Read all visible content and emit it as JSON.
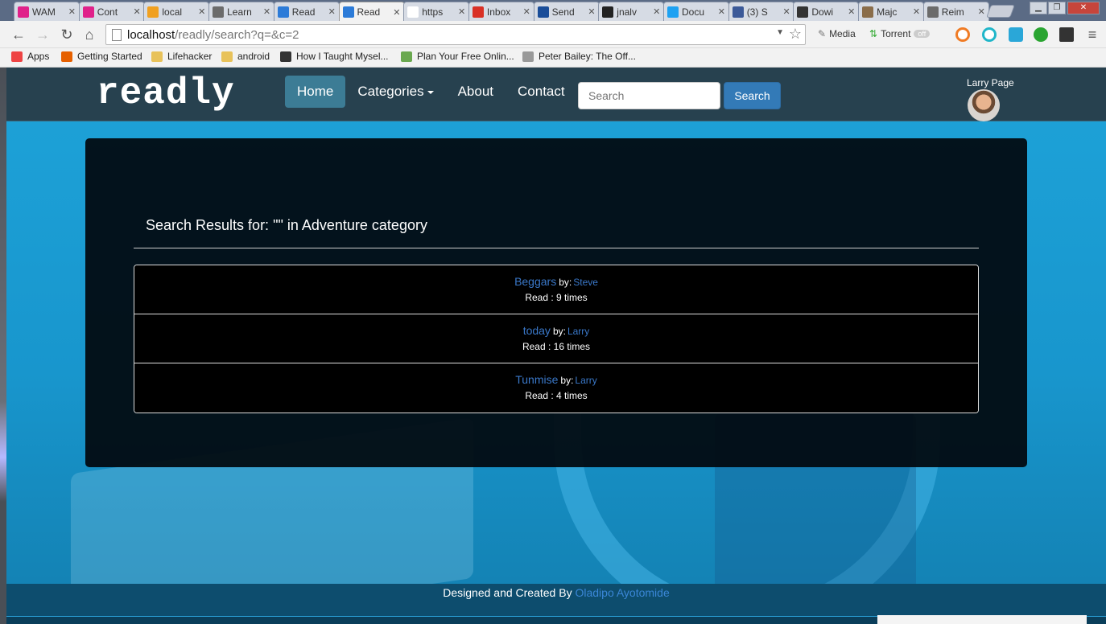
{
  "browser": {
    "tabs": [
      {
        "title": "WAM",
        "color": "#e0218a"
      },
      {
        "title": "Cont",
        "color": "#e0218a"
      },
      {
        "title": "local",
        "color": "#f0a020"
      },
      {
        "title": "Learn",
        "color": "#6b6b6b"
      },
      {
        "title": "Read",
        "color": "#2c7bd8"
      },
      {
        "title": "Read",
        "color": "#2c7bd8"
      },
      {
        "title": "https",
        "color": "#ffffff"
      },
      {
        "title": "Inbox",
        "color": "#d93025"
      },
      {
        "title": "Send",
        "color": "#1a4d99"
      },
      {
        "title": "jnalv",
        "color": "#222222"
      },
      {
        "title": "Docu",
        "color": "#1da1f2"
      },
      {
        "title": "(3) S",
        "color": "#3b5998"
      },
      {
        "title": "Dowi",
        "color": "#333333"
      },
      {
        "title": "Majc",
        "color": "#8a6d4a"
      },
      {
        "title": "Reim",
        "color": "#6b6b6b"
      }
    ],
    "active_tab_index": 5,
    "url_host": "localhost",
    "url_path": "/readly/search?q=&c=2",
    "toolbar_ext": {
      "media": "Media",
      "torrent": "Torrent",
      "toggle": "off"
    },
    "bookmarks": [
      {
        "label": "Apps",
        "color": "#e44"
      },
      {
        "label": "Getting Started",
        "color": "#e66000"
      },
      {
        "label": "Lifehacker",
        "color": "#e8c25a"
      },
      {
        "label": "android",
        "color": "#e8c25a"
      },
      {
        "label": "How I Taught Mysel...",
        "color": "#333"
      },
      {
        "label": "Plan Your Free Onlin...",
        "color": "#6aa84f"
      },
      {
        "label": "Peter Bailey: The Off...",
        "color": "#999"
      }
    ]
  },
  "site": {
    "brand": "readly",
    "nav": {
      "home": "Home",
      "categories": "Categories",
      "about": "About",
      "contact": "Contact"
    },
    "search": {
      "placeholder": "Search",
      "button": "Search"
    },
    "user": {
      "name": "Larry Page"
    }
  },
  "results": {
    "heading": "Search Results for: \"\" in Adventure category",
    "by_label": "by:",
    "items": [
      {
        "title": "Beggars",
        "author": "Steve",
        "reads": "Read : 9 times"
      },
      {
        "title": "today",
        "author": "Larry",
        "reads": "Read : 16 times"
      },
      {
        "title": "Tunmise",
        "author": "Larry",
        "reads": "Read : 4 times"
      }
    ]
  },
  "footer": {
    "text": "Designed and Created By ",
    "link": "Oladipo Ayotomide"
  }
}
